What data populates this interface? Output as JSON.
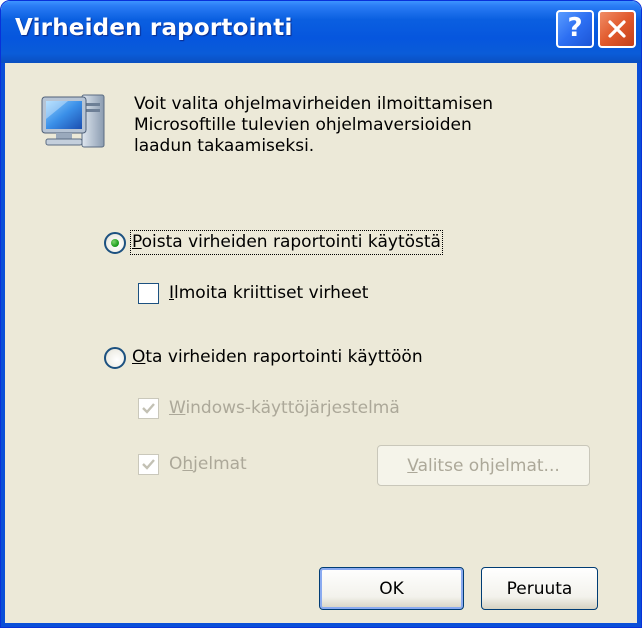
{
  "window": {
    "title": "Virheiden raportointi",
    "help_label": "?",
    "close_label": "✕"
  },
  "description": {
    "line1": "Voit valita ohjelmavirheiden ilmoittamisen",
    "line2": "Microsoftille tulevien ohjelmaversioiden",
    "line3": "laadun takaamiseksi."
  },
  "options": {
    "disable_reporting": {
      "hotkey": "P",
      "rest": "oista virheiden raportointi käytöstä",
      "selected": true
    },
    "critical_errors": {
      "hotkey": "I",
      "rest": "lmoita kriittiset virheet",
      "checked": false
    },
    "enable_reporting": {
      "hotkey": "O",
      "rest": "ta virheiden raportointi käyttöön",
      "selected": false
    },
    "windows_os": {
      "hotkey": "W",
      "rest": "indows-käyttöjärjestelmä",
      "checked": true,
      "enabled": false
    },
    "programs": {
      "pre": "O",
      "hotkey": "h",
      "rest": "jelmat",
      "checked": true,
      "enabled": false
    }
  },
  "buttons": {
    "choose_programs": {
      "hotkey": "V",
      "rest": "alitse ohjelmat..."
    },
    "ok": "OK",
    "cancel": "Peruuta"
  }
}
